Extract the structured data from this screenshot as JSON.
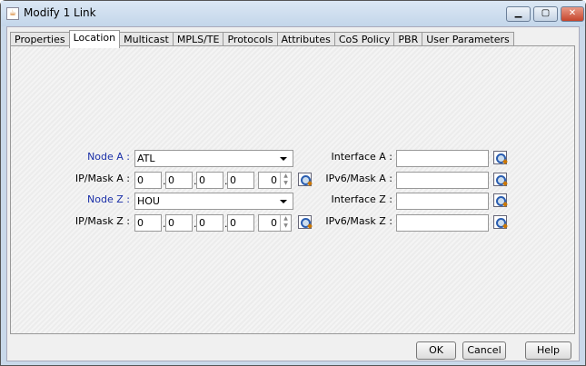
{
  "window": {
    "title": "Modify 1 Link",
    "controls": [
      "minimize",
      "maximize",
      "close"
    ]
  },
  "tabs": [
    {
      "label": "Properties"
    },
    {
      "label": "Location",
      "active": true
    },
    {
      "label": "Multicast"
    },
    {
      "label": "MPLS/TE"
    },
    {
      "label": "Protocols"
    },
    {
      "label": "Attributes"
    },
    {
      "label": "CoS Policy"
    },
    {
      "label": "PBR"
    },
    {
      "label": "User Parameters"
    }
  ],
  "form": {
    "node_a": {
      "label": "Node A :",
      "value": "ATL"
    },
    "ip_mask_a": {
      "label": "IP/Mask A :",
      "octets": [
        "0",
        "0",
        "0",
        "0"
      ],
      "mask": "0"
    },
    "node_z": {
      "label": "Node Z :",
      "value": "HOU"
    },
    "ip_mask_z": {
      "label": "IP/Mask Z :",
      "octets": [
        "0",
        "0",
        "0",
        "0"
      ],
      "mask": "0"
    },
    "interface_a": {
      "label": "Interface A :",
      "value": ""
    },
    "ipv6_mask_a": {
      "label": "IPv6/Mask A :",
      "value": ""
    },
    "interface_z": {
      "label": "Interface Z :",
      "value": ""
    },
    "ipv6_mask_z": {
      "label": "IPv6/Mask Z :",
      "value": ""
    }
  },
  "buttons": {
    "ok": "OK",
    "cancel": "Cancel",
    "help": "Help"
  },
  "colors": {
    "node_label": "#1a2fa8"
  }
}
